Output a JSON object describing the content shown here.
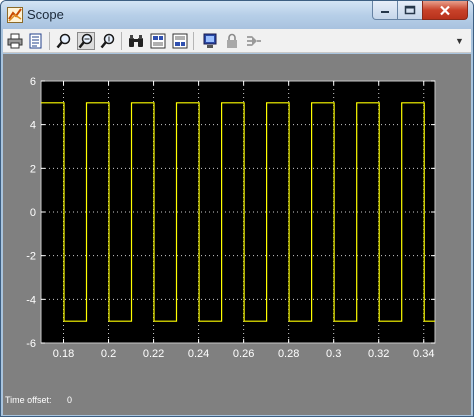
{
  "window": {
    "title": "Scope"
  },
  "toolbar": {
    "buttons": [
      {
        "icon": "print-icon"
      },
      {
        "icon": "parameters-icon"
      },
      {
        "icon": "zoom-icon"
      },
      {
        "icon": "zoom-x-icon",
        "pressed": true
      },
      {
        "icon": "zoom-y-icon"
      },
      {
        "icon": "autoscale-binoculars-icon"
      },
      {
        "icon": "save-axes-icon"
      },
      {
        "icon": "restore-axes-icon"
      },
      {
        "icon": "floating-scope-icon"
      },
      {
        "icon": "lock-axes-icon"
      },
      {
        "icon": "signal-selector-icon"
      }
    ]
  },
  "footer": {
    "time_offset_label": "Time offset:",
    "time_offset_value": "0"
  },
  "colors": {
    "plot_background": "#000000",
    "figure_background": "#808080",
    "trace": "#ffff00",
    "axis_text": "#ffffff"
  },
  "chart_data": {
    "type": "line",
    "title": "",
    "xlabel": "",
    "ylabel": "",
    "xlim": [
      0.17,
      0.345
    ],
    "ylim": [
      -6,
      6
    ],
    "grid": true,
    "xticks": [
      0.18,
      0.2,
      0.22,
      0.24,
      0.26,
      0.28,
      0.3,
      0.32,
      0.34
    ],
    "xtick_labels": [
      "0.18",
      "0.2",
      "0.22",
      "0.24",
      "0.26",
      "0.28",
      "0.3",
      "0.32",
      "0.34"
    ],
    "yticks": [
      -6,
      -4,
      -2,
      0,
      2,
      4,
      6
    ],
    "ytick_labels": [
      "-6",
      "-4",
      "-2",
      "0",
      "2",
      "4",
      "6"
    ],
    "series": [
      {
        "x": [
          0.17,
          0.1802,
          0.1802,
          0.1902,
          0.1902,
          0.2002,
          0.2002,
          0.2102,
          0.2102,
          0.2202,
          0.2202,
          0.2302,
          0.2302,
          0.2402,
          0.2402,
          0.2502,
          0.2502,
          0.2602,
          0.2602,
          0.2702,
          0.2702,
          0.2802,
          0.2802,
          0.2902,
          0.2902,
          0.3002,
          0.3002,
          0.3102,
          0.3102,
          0.3202,
          0.3202,
          0.3302,
          0.3302,
          0.3402,
          0.3402,
          0.345
        ],
        "y": [
          5,
          5,
          -5,
          -5,
          5,
          5,
          -5,
          -5,
          5,
          5,
          -5,
          -5,
          5,
          5,
          -5,
          -5,
          5,
          5,
          -5,
          -5,
          5,
          5,
          -5,
          -5,
          5,
          5,
          -5,
          -5,
          5,
          5,
          -5,
          -5,
          5,
          5,
          -5,
          -5
        ]
      }
    ]
  }
}
